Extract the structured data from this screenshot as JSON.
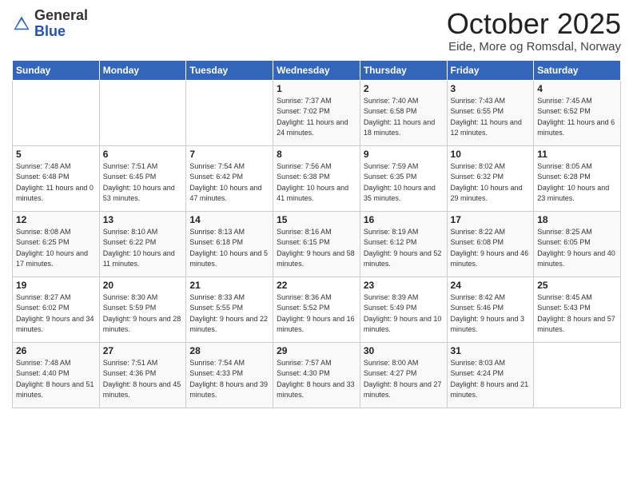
{
  "logo": {
    "general": "General",
    "blue": "Blue"
  },
  "header": {
    "month": "October 2025",
    "location": "Eide, More og Romsdal, Norway"
  },
  "days_of_week": [
    "Sunday",
    "Monday",
    "Tuesday",
    "Wednesday",
    "Thursday",
    "Friday",
    "Saturday"
  ],
  "weeks": [
    [
      {
        "day": "",
        "sunrise": "",
        "sunset": "",
        "daylight": ""
      },
      {
        "day": "",
        "sunrise": "",
        "sunset": "",
        "daylight": ""
      },
      {
        "day": "",
        "sunrise": "",
        "sunset": "",
        "daylight": ""
      },
      {
        "day": "1",
        "sunrise": "Sunrise: 7:37 AM",
        "sunset": "Sunset: 7:02 PM",
        "daylight": "Daylight: 11 hours and 24 minutes."
      },
      {
        "day": "2",
        "sunrise": "Sunrise: 7:40 AM",
        "sunset": "Sunset: 6:58 PM",
        "daylight": "Daylight: 11 hours and 18 minutes."
      },
      {
        "day": "3",
        "sunrise": "Sunrise: 7:43 AM",
        "sunset": "Sunset: 6:55 PM",
        "daylight": "Daylight: 11 hours and 12 minutes."
      },
      {
        "day": "4",
        "sunrise": "Sunrise: 7:45 AM",
        "sunset": "Sunset: 6:52 PM",
        "daylight": "Daylight: 11 hours and 6 minutes."
      }
    ],
    [
      {
        "day": "5",
        "sunrise": "Sunrise: 7:48 AM",
        "sunset": "Sunset: 6:48 PM",
        "daylight": "Daylight: 11 hours and 0 minutes."
      },
      {
        "day": "6",
        "sunrise": "Sunrise: 7:51 AM",
        "sunset": "Sunset: 6:45 PM",
        "daylight": "Daylight: 10 hours and 53 minutes."
      },
      {
        "day": "7",
        "sunrise": "Sunrise: 7:54 AM",
        "sunset": "Sunset: 6:42 PM",
        "daylight": "Daylight: 10 hours and 47 minutes."
      },
      {
        "day": "8",
        "sunrise": "Sunrise: 7:56 AM",
        "sunset": "Sunset: 6:38 PM",
        "daylight": "Daylight: 10 hours and 41 minutes."
      },
      {
        "day": "9",
        "sunrise": "Sunrise: 7:59 AM",
        "sunset": "Sunset: 6:35 PM",
        "daylight": "Daylight: 10 hours and 35 minutes."
      },
      {
        "day": "10",
        "sunrise": "Sunrise: 8:02 AM",
        "sunset": "Sunset: 6:32 PM",
        "daylight": "Daylight: 10 hours and 29 minutes."
      },
      {
        "day": "11",
        "sunrise": "Sunrise: 8:05 AM",
        "sunset": "Sunset: 6:28 PM",
        "daylight": "Daylight: 10 hours and 23 minutes."
      }
    ],
    [
      {
        "day": "12",
        "sunrise": "Sunrise: 8:08 AM",
        "sunset": "Sunset: 6:25 PM",
        "daylight": "Daylight: 10 hours and 17 minutes."
      },
      {
        "day": "13",
        "sunrise": "Sunrise: 8:10 AM",
        "sunset": "Sunset: 6:22 PM",
        "daylight": "Daylight: 10 hours and 11 minutes."
      },
      {
        "day": "14",
        "sunrise": "Sunrise: 8:13 AM",
        "sunset": "Sunset: 6:18 PM",
        "daylight": "Daylight: 10 hours and 5 minutes."
      },
      {
        "day": "15",
        "sunrise": "Sunrise: 8:16 AM",
        "sunset": "Sunset: 6:15 PM",
        "daylight": "Daylight: 9 hours and 58 minutes."
      },
      {
        "day": "16",
        "sunrise": "Sunrise: 8:19 AM",
        "sunset": "Sunset: 6:12 PM",
        "daylight": "Daylight: 9 hours and 52 minutes."
      },
      {
        "day": "17",
        "sunrise": "Sunrise: 8:22 AM",
        "sunset": "Sunset: 6:08 PM",
        "daylight": "Daylight: 9 hours and 46 minutes."
      },
      {
        "day": "18",
        "sunrise": "Sunrise: 8:25 AM",
        "sunset": "Sunset: 6:05 PM",
        "daylight": "Daylight: 9 hours and 40 minutes."
      }
    ],
    [
      {
        "day": "19",
        "sunrise": "Sunrise: 8:27 AM",
        "sunset": "Sunset: 6:02 PM",
        "daylight": "Daylight: 9 hours and 34 minutes."
      },
      {
        "day": "20",
        "sunrise": "Sunrise: 8:30 AM",
        "sunset": "Sunset: 5:59 PM",
        "daylight": "Daylight: 9 hours and 28 minutes."
      },
      {
        "day": "21",
        "sunrise": "Sunrise: 8:33 AM",
        "sunset": "Sunset: 5:55 PM",
        "daylight": "Daylight: 9 hours and 22 minutes."
      },
      {
        "day": "22",
        "sunrise": "Sunrise: 8:36 AM",
        "sunset": "Sunset: 5:52 PM",
        "daylight": "Daylight: 9 hours and 16 minutes."
      },
      {
        "day": "23",
        "sunrise": "Sunrise: 8:39 AM",
        "sunset": "Sunset: 5:49 PM",
        "daylight": "Daylight: 9 hours and 10 minutes."
      },
      {
        "day": "24",
        "sunrise": "Sunrise: 8:42 AM",
        "sunset": "Sunset: 5:46 PM",
        "daylight": "Daylight: 9 hours and 3 minutes."
      },
      {
        "day": "25",
        "sunrise": "Sunrise: 8:45 AM",
        "sunset": "Sunset: 5:43 PM",
        "daylight": "Daylight: 8 hours and 57 minutes."
      }
    ],
    [
      {
        "day": "26",
        "sunrise": "Sunrise: 7:48 AM",
        "sunset": "Sunset: 4:40 PM",
        "daylight": "Daylight: 8 hours and 51 minutes."
      },
      {
        "day": "27",
        "sunrise": "Sunrise: 7:51 AM",
        "sunset": "Sunset: 4:36 PM",
        "daylight": "Daylight: 8 hours and 45 minutes."
      },
      {
        "day": "28",
        "sunrise": "Sunrise: 7:54 AM",
        "sunset": "Sunset: 4:33 PM",
        "daylight": "Daylight: 8 hours and 39 minutes."
      },
      {
        "day": "29",
        "sunrise": "Sunrise: 7:57 AM",
        "sunset": "Sunset: 4:30 PM",
        "daylight": "Daylight: 8 hours and 33 minutes."
      },
      {
        "day": "30",
        "sunrise": "Sunrise: 8:00 AM",
        "sunset": "Sunset: 4:27 PM",
        "daylight": "Daylight: 8 hours and 27 minutes."
      },
      {
        "day": "31",
        "sunrise": "Sunrise: 8:03 AM",
        "sunset": "Sunset: 4:24 PM",
        "daylight": "Daylight: 8 hours and 21 minutes."
      },
      {
        "day": "",
        "sunrise": "",
        "sunset": "",
        "daylight": ""
      }
    ]
  ]
}
